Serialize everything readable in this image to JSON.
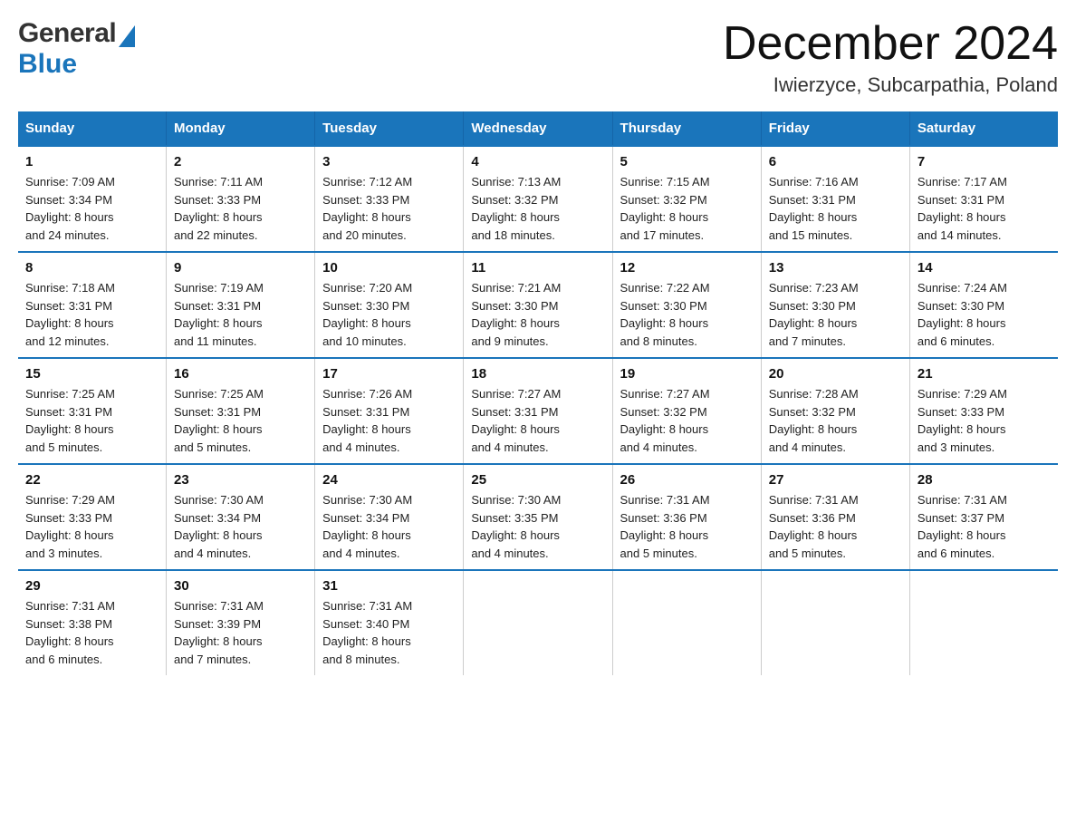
{
  "header": {
    "title": "December 2024",
    "subtitle": "Iwierzyce, Subcarpathia, Poland",
    "logo_general": "General",
    "logo_blue": "Blue"
  },
  "days_of_week": [
    "Sunday",
    "Monday",
    "Tuesday",
    "Wednesday",
    "Thursday",
    "Friday",
    "Saturday"
  ],
  "weeks": [
    [
      {
        "day": "1",
        "sunrise": "7:09 AM",
        "sunset": "3:34 PM",
        "daylight": "8 hours and 24 minutes."
      },
      {
        "day": "2",
        "sunrise": "7:11 AM",
        "sunset": "3:33 PM",
        "daylight": "8 hours and 22 minutes."
      },
      {
        "day": "3",
        "sunrise": "7:12 AM",
        "sunset": "3:33 PM",
        "daylight": "8 hours and 20 minutes."
      },
      {
        "day": "4",
        "sunrise": "7:13 AM",
        "sunset": "3:32 PM",
        "daylight": "8 hours and 18 minutes."
      },
      {
        "day": "5",
        "sunrise": "7:15 AM",
        "sunset": "3:32 PM",
        "daylight": "8 hours and 17 minutes."
      },
      {
        "day": "6",
        "sunrise": "7:16 AM",
        "sunset": "3:31 PM",
        "daylight": "8 hours and 15 minutes."
      },
      {
        "day": "7",
        "sunrise": "7:17 AM",
        "sunset": "3:31 PM",
        "daylight": "8 hours and 14 minutes."
      }
    ],
    [
      {
        "day": "8",
        "sunrise": "7:18 AM",
        "sunset": "3:31 PM",
        "daylight": "8 hours and 12 minutes."
      },
      {
        "day": "9",
        "sunrise": "7:19 AM",
        "sunset": "3:31 PM",
        "daylight": "8 hours and 11 minutes."
      },
      {
        "day": "10",
        "sunrise": "7:20 AM",
        "sunset": "3:30 PM",
        "daylight": "8 hours and 10 minutes."
      },
      {
        "day": "11",
        "sunrise": "7:21 AM",
        "sunset": "3:30 PM",
        "daylight": "8 hours and 9 minutes."
      },
      {
        "day": "12",
        "sunrise": "7:22 AM",
        "sunset": "3:30 PM",
        "daylight": "8 hours and 8 minutes."
      },
      {
        "day": "13",
        "sunrise": "7:23 AM",
        "sunset": "3:30 PM",
        "daylight": "8 hours and 7 minutes."
      },
      {
        "day": "14",
        "sunrise": "7:24 AM",
        "sunset": "3:30 PM",
        "daylight": "8 hours and 6 minutes."
      }
    ],
    [
      {
        "day": "15",
        "sunrise": "7:25 AM",
        "sunset": "3:31 PM",
        "daylight": "8 hours and 5 minutes."
      },
      {
        "day": "16",
        "sunrise": "7:25 AM",
        "sunset": "3:31 PM",
        "daylight": "8 hours and 5 minutes."
      },
      {
        "day": "17",
        "sunrise": "7:26 AM",
        "sunset": "3:31 PM",
        "daylight": "8 hours and 4 minutes."
      },
      {
        "day": "18",
        "sunrise": "7:27 AM",
        "sunset": "3:31 PM",
        "daylight": "8 hours and 4 minutes."
      },
      {
        "day": "19",
        "sunrise": "7:27 AM",
        "sunset": "3:32 PM",
        "daylight": "8 hours and 4 minutes."
      },
      {
        "day": "20",
        "sunrise": "7:28 AM",
        "sunset": "3:32 PM",
        "daylight": "8 hours and 4 minutes."
      },
      {
        "day": "21",
        "sunrise": "7:29 AM",
        "sunset": "3:33 PM",
        "daylight": "8 hours and 3 minutes."
      }
    ],
    [
      {
        "day": "22",
        "sunrise": "7:29 AM",
        "sunset": "3:33 PM",
        "daylight": "8 hours and 3 minutes."
      },
      {
        "day": "23",
        "sunrise": "7:30 AM",
        "sunset": "3:34 PM",
        "daylight": "8 hours and 4 minutes."
      },
      {
        "day": "24",
        "sunrise": "7:30 AM",
        "sunset": "3:34 PM",
        "daylight": "8 hours and 4 minutes."
      },
      {
        "day": "25",
        "sunrise": "7:30 AM",
        "sunset": "3:35 PM",
        "daylight": "8 hours and 4 minutes."
      },
      {
        "day": "26",
        "sunrise": "7:31 AM",
        "sunset": "3:36 PM",
        "daylight": "8 hours and 5 minutes."
      },
      {
        "day": "27",
        "sunrise": "7:31 AM",
        "sunset": "3:36 PM",
        "daylight": "8 hours and 5 minutes."
      },
      {
        "day": "28",
        "sunrise": "7:31 AM",
        "sunset": "3:37 PM",
        "daylight": "8 hours and 6 minutes."
      }
    ],
    [
      {
        "day": "29",
        "sunrise": "7:31 AM",
        "sunset": "3:38 PM",
        "daylight": "8 hours and 6 minutes."
      },
      {
        "day": "30",
        "sunrise": "7:31 AM",
        "sunset": "3:39 PM",
        "daylight": "8 hours and 7 minutes."
      },
      {
        "day": "31",
        "sunrise": "7:31 AM",
        "sunset": "3:40 PM",
        "daylight": "8 hours and 8 minutes."
      },
      null,
      null,
      null,
      null
    ]
  ],
  "labels": {
    "sunrise": "Sunrise:",
    "sunset": "Sunset:",
    "daylight": "Daylight:"
  }
}
